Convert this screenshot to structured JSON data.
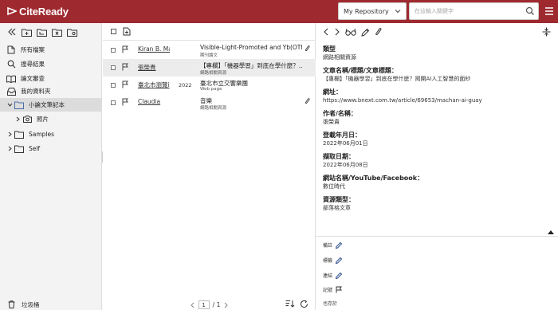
{
  "app": {
    "name": "CiteReady"
  },
  "header": {
    "repo_select": "My Repository",
    "search_placeholder": "在這輸入關鍵字"
  },
  "sidebar": {
    "items": [
      {
        "label": "所有檔案",
        "icon": "file-icon"
      },
      {
        "label": "搜尋結果",
        "icon": "search-icon"
      },
      {
        "label": "論文審查",
        "icon": "book-icon"
      },
      {
        "label": "我的資料夾",
        "icon": "inbox-icon"
      },
      {
        "label": "小論文筆記本",
        "icon": "folder-icon"
      },
      {
        "label": "照片",
        "icon": "camera-icon"
      },
      {
        "label": "Samples",
        "icon": "folder-icon"
      },
      {
        "label": "Self",
        "icon": "folder-icon"
      }
    ],
    "trash_label": "垃圾桶"
  },
  "list": {
    "rows": [
      {
        "author": "Kiran B. Mar",
        "year": "",
        "title": "Visible-Light-Promoted and Yb(OTf)...",
        "type": "期刊論文",
        "attachment": true
      },
      {
        "author": "張榮貴",
        "year": "",
        "title": "【專欄】「機器學習」到底在學什麼？...",
        "type": "網路相關資源",
        "attachment": false
      },
      {
        "author": "臺北市瀏覽i",
        "year": "2022",
        "title": "臺北市立交響樂團",
        "type": "Web page",
        "attachment": false
      },
      {
        "author": "Claudia",
        "year": "",
        "title": "音樂",
        "type": "網路相關資源",
        "attachment": true
      }
    ],
    "pager": {
      "current": "1",
      "total": "/ 1"
    }
  },
  "detail": {
    "fields": [
      {
        "label": "類型",
        "value": "網路相關資源"
      },
      {
        "label": "文章名稱/標題/文章標題：",
        "value": "【專欄】「機器學習」到底在學什麼？揭開AI人工智慧的面紗"
      },
      {
        "label": "網址：",
        "value": "https://www.bnext.com.tw/article/69653/machan-ai-guay"
      },
      {
        "label": "作者/名稱：",
        "value": "張榮貴"
      },
      {
        "label": "登載年月日：",
        "value": "2022年06月01日"
      },
      {
        "label": "擷取日期：",
        "value": "2022年06月08日"
      },
      {
        "label": "網站名稱/YouTube/Facebook：",
        "value": "數位時代"
      },
      {
        "label": "資源類型：",
        "value": "部落格文章"
      }
    ],
    "sections": [
      {
        "label": "備註",
        "icon": "pencil-icon"
      },
      {
        "label": "標籤",
        "icon": "pencil-icon"
      },
      {
        "label": "連結",
        "icon": "pencil-icon"
      },
      {
        "label": "記號",
        "icon": "flag-icon"
      },
      {
        "label": "也存於",
        "icon": ""
      }
    ]
  },
  "colors": {
    "header": "#9e2a2f"
  }
}
